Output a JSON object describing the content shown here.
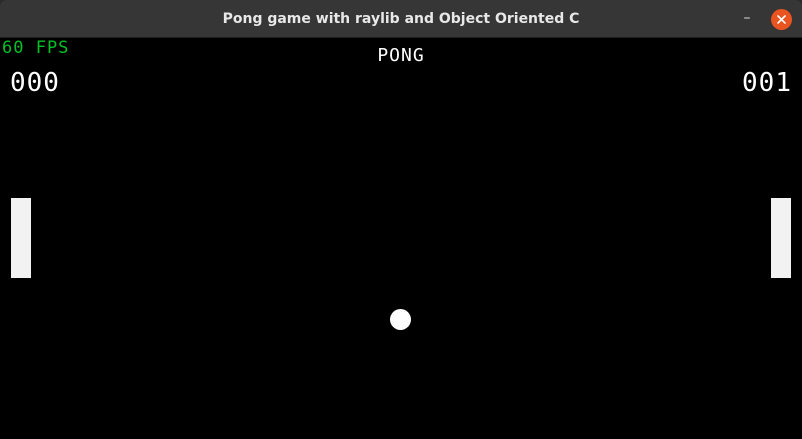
{
  "window": {
    "title": "Pong game with raylib and Object Oriented C",
    "minimize_glyph": "–",
    "close_color": "#e95420"
  },
  "game": {
    "fps": "60 FPS",
    "title": "PONG",
    "score_left": "000",
    "score_right": "001",
    "fps_color": "#00c026",
    "paddle_color": "#f2f2f2",
    "ball_color": "#ffffff",
    "background_color": "#000000"
  }
}
